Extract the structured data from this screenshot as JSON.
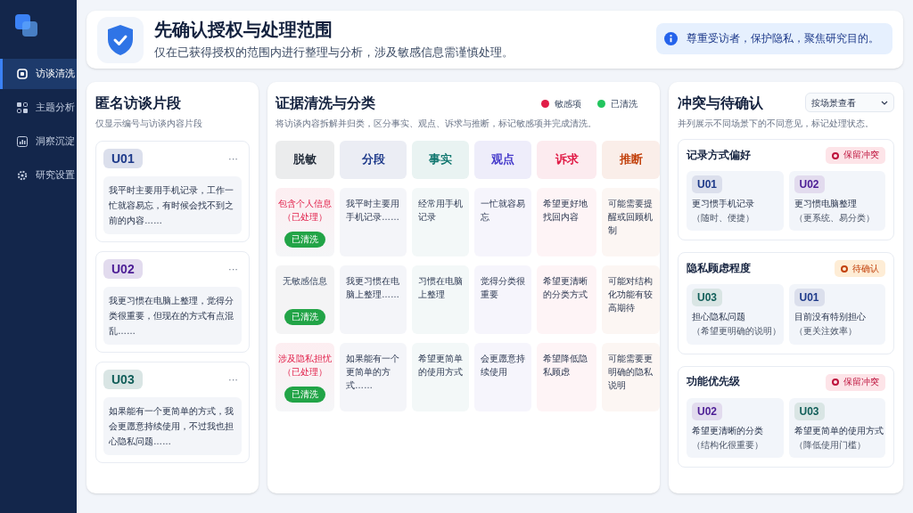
{
  "sidebar": {
    "items": [
      {
        "label": "访谈清洗",
        "selected": true
      },
      {
        "label": "主题分析",
        "selected": false
      },
      {
        "label": "洞察沉淀",
        "selected": false
      },
      {
        "label": "研究设置",
        "selected": false
      }
    ]
  },
  "header": {
    "title": "先确认授权与处理范围",
    "subtitle": "仅在已获得授权的范围内进行整理与分析，涉及敏感信息需谨慎处理。",
    "notice": "尊重受访者，保护隐私，聚焦研究目的。"
  },
  "snippets": {
    "title": "匿名访谈片段",
    "subtitle": "仅显示编号与访谈内容片段",
    "items": [
      {
        "id": "U01",
        "color": "#1e3a8a",
        "menu": "···",
        "text": "我平时主要用手机记录，工作一忙就容易忘，有时候会找不到之前的内容……"
      },
      {
        "id": "U02",
        "color": "#4c1d95",
        "menu": "···",
        "text": "我更习惯在电脑上整理，觉得分类很重要，但现在的方式有点混乱……"
      },
      {
        "id": "U03",
        "color": "#115e59",
        "menu": "···",
        "text": "如果能有一个更简单的方式，我会更愿意持续使用，不过我也担心隐私问题……"
      }
    ]
  },
  "evidence": {
    "title": "证据清洗与分类",
    "subtitle": "将访谈内容拆解并归类，区分事实、观点、诉求与推断，标记敏感项并完成清洗。",
    "legend": [
      {
        "label": "敏感项",
        "color": "#e11d48"
      },
      {
        "label": "已清洗",
        "color": "#22c55e"
      }
    ],
    "columns": [
      {
        "label": "脱敏",
        "color": "#1f2937"
      },
      {
        "label": "分段",
        "color": "#1e3a8a"
      },
      {
        "label": "事实",
        "color": "#0f766e"
      },
      {
        "label": "观点",
        "color": "#4338ca"
      },
      {
        "label": "诉求",
        "color": "#e11d48"
      },
      {
        "label": "推断",
        "color": "#c2410c"
      }
    ],
    "rows": [
      {
        "cells": [
          {
            "kind": "desens",
            "text": "包含个人信息",
            "note": "（已处理）",
            "sensitive": true,
            "cleaned": true,
            "badge": "已清洗"
          },
          {
            "kind": "text",
            "text": "我平时主要用手机记录……"
          },
          {
            "kind": "text",
            "text": "经常用手机记录"
          },
          {
            "kind": "text",
            "text": "一忙就容易忘"
          },
          {
            "kind": "text",
            "text": "希望更好地找回内容"
          },
          {
            "kind": "text",
            "text": "可能需要提醒或回顾机制"
          }
        ]
      },
      {
        "cells": [
          {
            "kind": "desens",
            "text": "无敏感信息",
            "sensitive": false,
            "cleaned": true,
            "badge": "已清洗"
          },
          {
            "kind": "text",
            "text": "我更习惯在电脑上整理……"
          },
          {
            "kind": "text",
            "text": "习惯在电脑上整理"
          },
          {
            "kind": "text",
            "text": "觉得分类很重要"
          },
          {
            "kind": "text",
            "text": "希望更清晰的分类方式"
          },
          {
            "kind": "text",
            "text": "可能对结构化功能有较高期待"
          }
        ]
      },
      {
        "cells": [
          {
            "kind": "desens",
            "text": "涉及隐私担忧",
            "note": "（已处理）",
            "sensitive": true,
            "cleaned": true,
            "badge": "已清洗"
          },
          {
            "kind": "text",
            "text": "如果能有一个更简单的方式……"
          },
          {
            "kind": "text",
            "text": "希望更简单的使用方式"
          },
          {
            "kind": "text",
            "text": "会更愿意持续使用"
          },
          {
            "kind": "text",
            "text": "希望降低隐私顾虑"
          },
          {
            "kind": "text",
            "text": "可能需要更明确的隐私说明"
          }
        ]
      }
    ]
  },
  "conflicts": {
    "title": "冲突与待确认",
    "filter": "按场景查看",
    "subtitle": "并列展示不同场景下的不同意见，标记处理状态。",
    "items": [
      {
        "topic": "记录方式偏好",
        "status": {
          "label": "保留冲突",
          "kind": "conflict"
        },
        "opinions": [
          {
            "id": "U01",
            "color": "#1e3a8a",
            "text": "更习惯手机记录",
            "note": "（随时、便捷）"
          },
          {
            "id": "U02",
            "color": "#4c1d95",
            "text": "更习惯电脑整理",
            "note": "（更系统、易分类）"
          }
        ]
      },
      {
        "topic": "隐私顾虑程度",
        "status": {
          "label": "待确认",
          "kind": "pending"
        },
        "opinions": [
          {
            "id": "U03",
            "color": "#115e59",
            "text": "担心隐私问题",
            "note": "（希望更明确的说明）"
          },
          {
            "id": "U01",
            "color": "#1e3a8a",
            "text": "目前没有特别担心",
            "note": "（更关注效率）"
          }
        ]
      },
      {
        "topic": "功能优先级",
        "status": {
          "label": "保留冲突",
          "kind": "conflict"
        },
        "opinions": [
          {
            "id": "U02",
            "color": "#4c1d95",
            "text": "希望更清晰的分类",
            "note": "（结构化很重要）"
          },
          {
            "id": "U03",
            "color": "#115e59",
            "text": "希望更简单的使用方式",
            "note": "（降低使用门槛）"
          }
        ]
      }
    ]
  }
}
